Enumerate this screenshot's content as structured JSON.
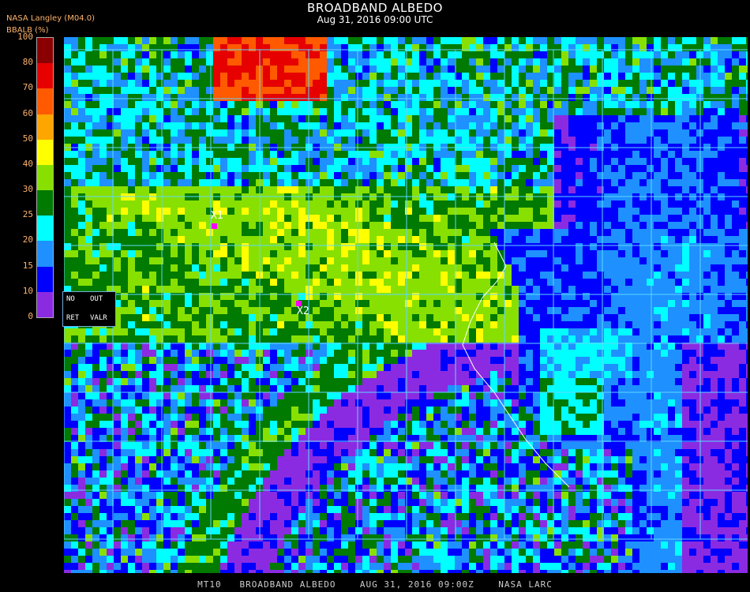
{
  "header": {
    "title": "BROADBAND ALBEDO",
    "datetime": "Aug 31, 2016 09:00 UTC",
    "source": "NASA Langley (M04.0)",
    "unit_label": "BBALB (%)"
  },
  "color_scale": {
    "ticks": [
      "100",
      "80",
      "70",
      "60",
      "50",
      "40",
      "30",
      "25",
      "20",
      "15",
      "10",
      "0"
    ],
    "bands": [
      {
        "range": "80-100",
        "color": "#8a0000"
      },
      {
        "range": "70-80",
        "color": "#e60000"
      },
      {
        "range": "60-70",
        "color": "#ff5a00"
      },
      {
        "range": "50-60",
        "color": "#ffa500"
      },
      {
        "range": "40-50",
        "color": "#ffff00"
      },
      {
        "range": "30-40",
        "color": "#88e000"
      },
      {
        "range": "25-30",
        "color": "#007a00"
      },
      {
        "range": "20-25",
        "color": "#00ffff"
      },
      {
        "range": "15-20",
        "color": "#1e90ff"
      },
      {
        "range": "10-15",
        "color": "#0000ff"
      },
      {
        "range": "0-10",
        "color": "#8a2be2"
      }
    ]
  },
  "legend": {
    "no": "NO",
    "out": "OUT",
    "ret": "RET",
    "valr": "VALR"
  },
  "markers": [
    {
      "label": "X1"
    },
    {
      "label": "X2"
    }
  ],
  "colors": {
    "grid": "#5fd7ff",
    "coast": "#ffffff",
    "marker": "#ff00ff"
  },
  "footer": "MT10   BROADBAND ALBEDO    AUG 31, 2016 09:00Z    NASA LARC"
}
